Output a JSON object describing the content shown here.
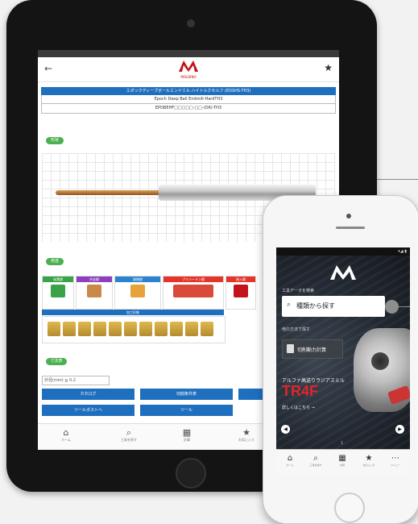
{
  "ipad": {
    "nav": {
      "back_icon": "←",
      "star_icon": "★",
      "logo_text": "MOLDINO"
    },
    "title": "エポックディープボールエンドミル ハイトルクセルフ (EDSHS-TH3)",
    "subtitle": "Epoch Deep Ball Endmill-HardTH3",
    "code": "EPDBEHF□□□□□-□□-(D6)-TH3",
    "sections": {
      "shape": "形状",
      "material": "用途",
      "type": "寸法表"
    },
    "categories": [
      {
        "label": "炭素鋼",
        "color": "#3aa34a"
      },
      {
        "label": "合金鋼",
        "color": "#8e3fbf"
      },
      {
        "label": "調質鋼",
        "color": "#2b82cf"
      },
      {
        "label": "プリハードン鋼",
        "color": "#e5342a"
      },
      {
        "label": "焼入鋼",
        "color": "#e5342a"
      }
    ],
    "strip_label": "加工形態",
    "search_value": "外径(mm) ≦ 0.2",
    "buttons": [
      "カタログ",
      "切削条件表",
      "",
      "ツールポストへ",
      "ツール"
    ],
    "tabs": [
      {
        "icon": "⌂",
        "label": "ホーム"
      },
      {
        "icon": "⌕",
        "label": "工具を探す"
      },
      {
        "icon": "▦",
        "label": "計算"
      },
      {
        "icon": "★",
        "label": "お気に入り"
      }
    ]
  },
  "iphone": {
    "status": "▾◢ ▮",
    "search_label": "工具データを検索",
    "search_placeholder": "種類から探す",
    "other_search": "他の方法で探す",
    "calc_button": "切削動力計算",
    "promo_line": "アルファ高送りラジアスミル",
    "promo_product": "TR4F",
    "promo_link": "詳しくはこちら →",
    "pager": "1",
    "tabs": [
      {
        "icon": "⌂",
        "label": "ホーム"
      },
      {
        "icon": "⌕",
        "label": "工具を探す"
      },
      {
        "icon": "▦",
        "label": "計算"
      },
      {
        "icon": "★",
        "label": "お気に入り"
      },
      {
        "icon": "⋯",
        "label": "メニュー"
      }
    ]
  }
}
